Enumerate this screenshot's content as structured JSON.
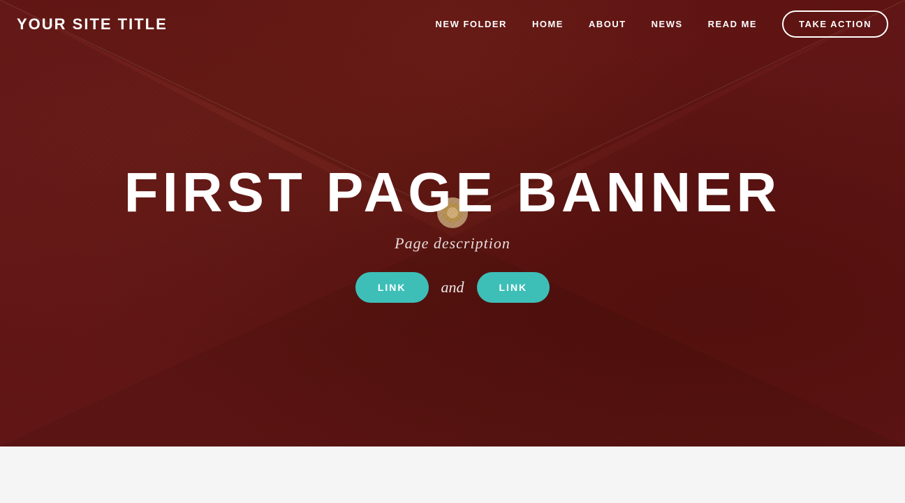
{
  "site": {
    "title": "YOUR SITE TITLE"
  },
  "navbar": {
    "links": [
      {
        "label": "NEW FOLDER",
        "id": "new-folder"
      },
      {
        "label": "HOME",
        "id": "home"
      },
      {
        "label": "ABOUT",
        "id": "about"
      },
      {
        "label": "NEWS",
        "id": "news"
      },
      {
        "label": "READ ME",
        "id": "read-me"
      }
    ],
    "cta_label": "TAKE ACTION"
  },
  "hero": {
    "banner_title": "FIRST PAGE BANNER",
    "description": "Page description",
    "btn1_label": "LINK",
    "btn_and": "and",
    "btn2_label": "LINK"
  },
  "colors": {
    "teal": "#3dbfb8",
    "dark_red": "#6b1a1a",
    "white": "#ffffff"
  }
}
